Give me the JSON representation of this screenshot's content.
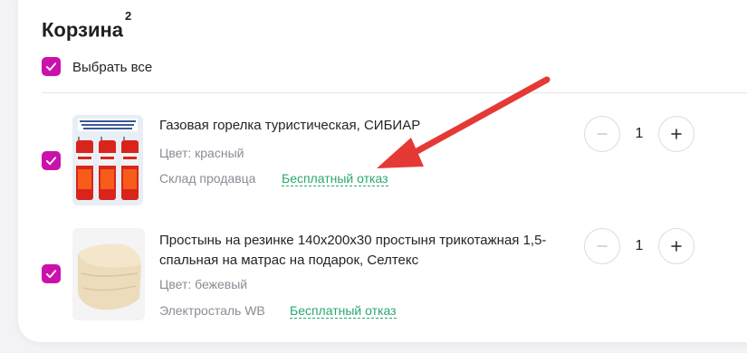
{
  "cart": {
    "title": "Корзина",
    "count": "2",
    "select_all_label": "Выбрать все"
  },
  "items": [
    {
      "name": "Газовая горелка туристическая, СИБИАР",
      "color": "Цвет: красный",
      "warehouse": "Склад продавца",
      "free_refusal": "Бесплатный отказ",
      "quantity": "1",
      "checked": true,
      "image_icon": "gas-canister-pack-image"
    },
    {
      "name_line1": "Простынь на резинке 140х200х30 простыня трикотажная 1,5-",
      "name_line2": "спальная на матрас на подарок, Селтекс",
      "color": "Цвет: бежевый",
      "warehouse": "Электросталь WB",
      "free_refusal": "Бесплатный отказ",
      "quantity": "1",
      "checked": true,
      "image_icon": "bed-sheet-image"
    }
  ],
  "colors": {
    "accent": "#cb11ab",
    "success": "#2aa86c",
    "annotation_arrow": "#e53935"
  }
}
